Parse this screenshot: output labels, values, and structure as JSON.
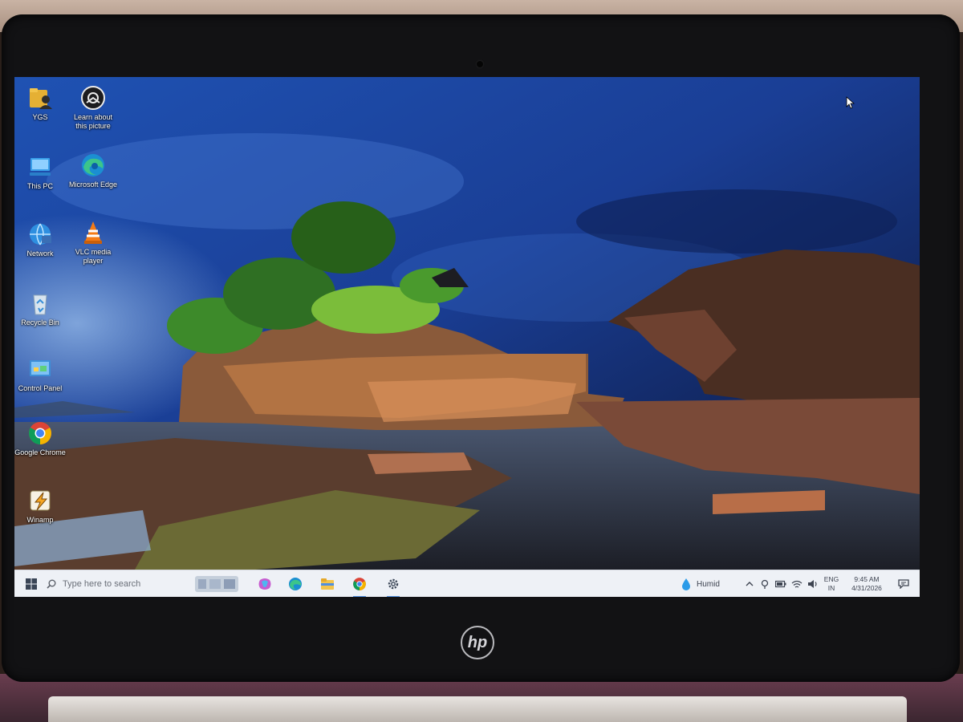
{
  "desktop": {
    "icons": [
      {
        "label": "YGS",
        "icon": "user-folder-icon"
      },
      {
        "label": "Learn about this picture",
        "icon": "camera-icon"
      },
      {
        "label": "This PC",
        "icon": "computer-icon"
      },
      {
        "label": "Microsoft Edge",
        "icon": "edge-icon"
      },
      {
        "label": "Network",
        "icon": "network-icon"
      },
      {
        "label": "VLC media player",
        "icon": "vlc-icon"
      },
      {
        "label": "Recycle Bin",
        "icon": "recycle-bin-icon"
      },
      {
        "label": "Control Panel",
        "icon": "control-panel-icon"
      },
      {
        "label": "Google Chrome",
        "icon": "chrome-icon"
      },
      {
        "label": "Winamp",
        "icon": "winamp-icon"
      }
    ]
  },
  "taskbar": {
    "search_placeholder": "Type here to search",
    "pinned": [
      {
        "name": "copilot-icon"
      },
      {
        "name": "edge-icon"
      },
      {
        "name": "file-explorer-icon"
      },
      {
        "name": "chrome-icon"
      },
      {
        "name": "settings-icon"
      }
    ],
    "weather": "Humid",
    "language_top": "ENG",
    "language_bottom": "IN",
    "time": "9:45 AM",
    "date": "4/31/2026"
  },
  "device": {
    "brand": "hp"
  },
  "colors": {
    "taskbar": "#eef1f6",
    "accent": "#4f8fe0",
    "sky": "#1b3f8a"
  }
}
